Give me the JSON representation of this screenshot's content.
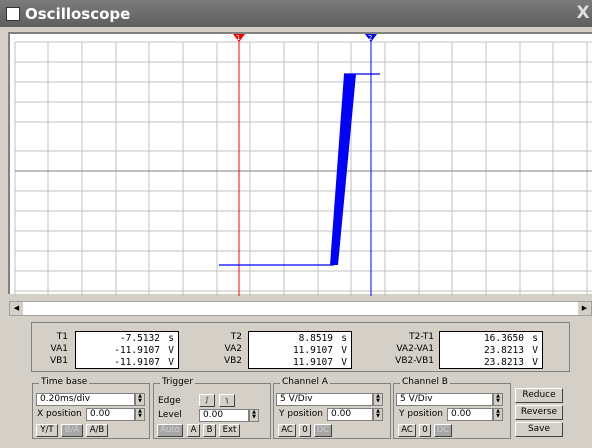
{
  "window": {
    "title": "Oscilloscope",
    "close_label": "X"
  },
  "markers": {
    "t1": "1",
    "t2": "2"
  },
  "measurements": {
    "labels": {
      "t1": "T1",
      "va1": "VA1",
      "vb1": "VB1",
      "t2": "T2",
      "va2": "VA2",
      "vb2": "VB2",
      "dt": "T2-T1",
      "dva": "VA2-VA1",
      "dvb": "VB2-VB1"
    },
    "t1": "-7.5132",
    "va1": "-11.9107",
    "vb1": "-11.9107",
    "t2": "8.8519",
    "va2": "11.9107",
    "vb2": "11.9107",
    "dt": "16.3650",
    "dva": "23.8213",
    "dvb": "23.8213",
    "unit_s": "s",
    "unit_v": "V"
  },
  "timebase": {
    "title": "Time base",
    "scale": "0.20ms/div",
    "xpos_label": "X position",
    "xpos": "0.00",
    "yt": "Y/T",
    "ba": "B/A",
    "ab": "A/B"
  },
  "trigger": {
    "title": "Trigger",
    "edge_label": "Edge",
    "level_label": "Level",
    "level": "0.00",
    "auto": "Auto",
    "a": "A",
    "b": "B",
    "ext": "Ext"
  },
  "channel_a": {
    "title": "Channel A",
    "scale": "5 V/Div",
    "ypos_label": "Y position",
    "ypos": "0.00",
    "ac": "AC",
    "zero": "0",
    "dc": "DC"
  },
  "channel_b": {
    "title": "Channel B",
    "scale": "5 V/Div",
    "ypos_label": "Y position",
    "ypos": "0.00",
    "ac": "AC",
    "zero": "0",
    "dc": "DC"
  },
  "side": {
    "reduce": "Reduce",
    "reverse": "Reverse",
    "save": "Save"
  },
  "colors": {
    "trace": "#0000ff",
    "cursor1": "#ff0000",
    "cursor2": "#0000ff",
    "grid": "#c0c0c0",
    "screen": "#ffffff"
  }
}
